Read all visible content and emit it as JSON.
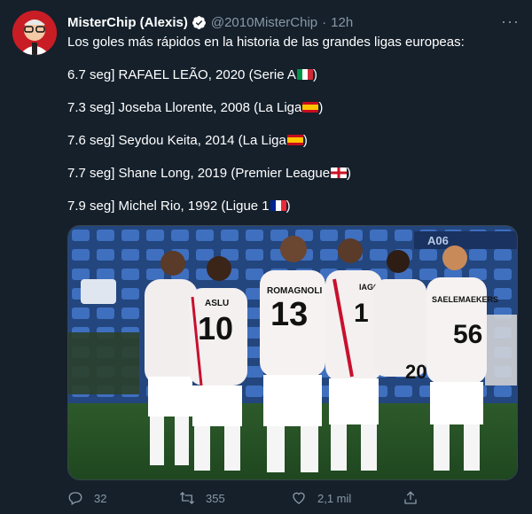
{
  "tweet": {
    "author_name": "MisterChip (Alexis)",
    "author_handle": "@2010MisterChip",
    "separator": "·",
    "time": "12h",
    "more_glyph": "···",
    "lines": [
      {
        "text": "Los goles más rápidos en la historia de las grandes ligas europeas:"
      },
      {
        "text": "6.7 seg] RAFAEL LEÃO, 2020 (Serie A",
        "close": ")",
        "flag": "italy-flag"
      },
      {
        "text": "7.3 seg] Joseba Llorente, 2008 (La Liga",
        "close": ")",
        "flag": "spain-flag"
      },
      {
        "text": "7.6 seg] Seydou Keita, 2014 (La Liga",
        "close": ")",
        "flag": "spain-flag"
      },
      {
        "text": "7.7 seg] Shane Long, 2019 (Premier League",
        "close": ")",
        "flag": "england-flag"
      },
      {
        "text": "7.9 seg] Michel Rio, 1992 (Ligue 1",
        "close": ")",
        "flag": "france-flag"
      }
    ],
    "photo": {
      "stand_sign": "A06",
      "jersey_numbers": [
        "10",
        "13",
        "56",
        "20",
        "1"
      ],
      "jersey_names": [
        "ROMAGNOLI",
        "IAGO",
        "SAELEMAEKERS",
        "ASLU"
      ]
    }
  },
  "actions": {
    "reply_count": "32",
    "retweet_count": "355",
    "like_count": "2,1 mil"
  },
  "colors": {
    "background": "#15202b",
    "secondary_text": "#8899a6",
    "verified": "#ffffff",
    "avatar_bg": "#c81d25"
  }
}
